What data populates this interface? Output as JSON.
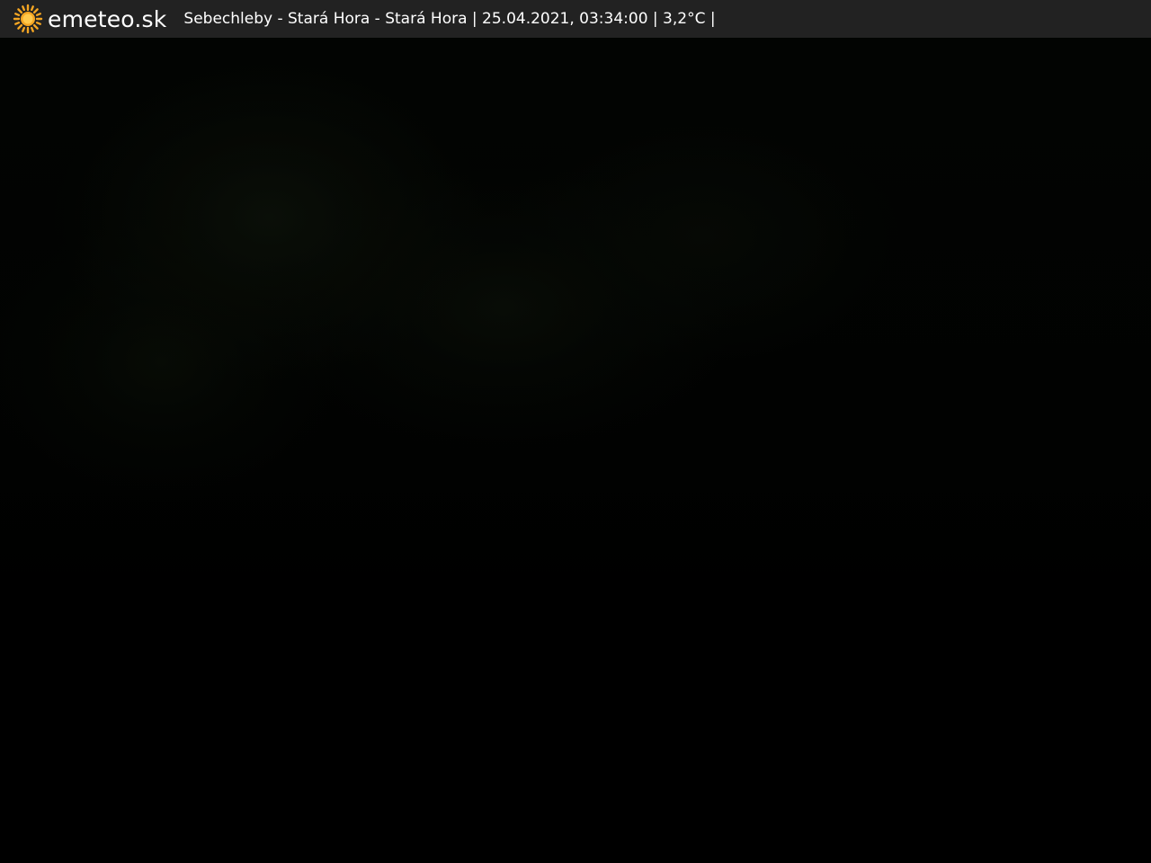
{
  "header": {
    "brand": "emeteo.sk",
    "caption": "Sebechleby - Stará Hora - Stará Hora | 25.04.2021, 03:34:00 | 3,2°C |",
    "icon": "sun-icon"
  },
  "colors": {
    "bar_background": "#222222",
    "text": "#ffffff",
    "sun": "#f5a623",
    "image_background": "#000000"
  }
}
